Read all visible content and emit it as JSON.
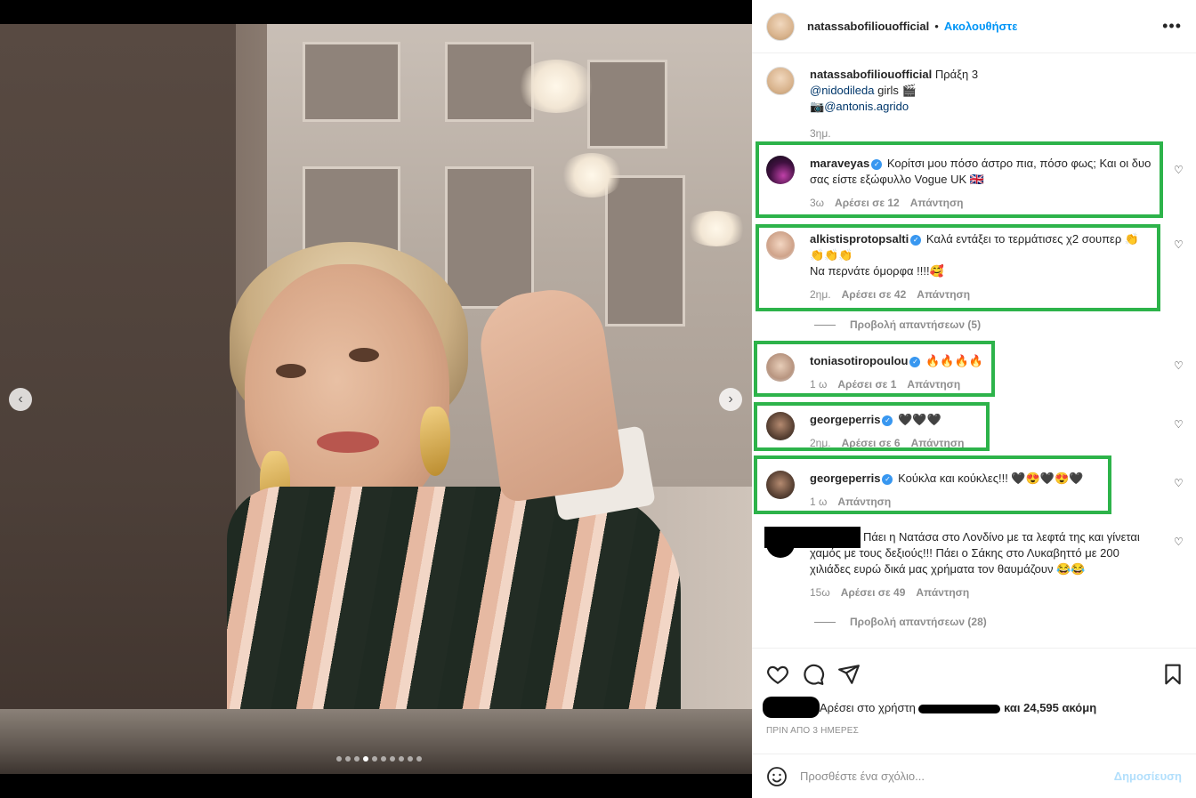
{
  "header": {
    "username": "natassabofiliouofficial",
    "separator": "•",
    "follow_label": "Ακολουθήστε",
    "more_icon": "more-icon"
  },
  "caption": {
    "username": "natassabofiliouofficial",
    "text_line1": "Πράξη 3",
    "mention1": "@nidodileda",
    "text_line2": " girls 🎬",
    "mention2": "@antonis.agrido",
    "mention2_prefix": "📷",
    "time": "3ημ."
  },
  "comments": [
    {
      "username": "maraveyas",
      "verified": true,
      "text": "Κορίτσι μου πόσο άστρο πια, πόσο φως; Και οι δυο σας είστε εξώφυλλο Vogue UK 🇬🇧",
      "time": "3ω",
      "likes": "Αρέσει σε 12",
      "reply": "Απάντηση"
    },
    {
      "username": "alkistisprotopsalti",
      "verified": true,
      "text": "Καλά εντάξει το τερμάτισες χ2 σουπερ 👏👏👏👏",
      "text2": "Να περνάτε όμορφα !!!!🥰",
      "time": "2ημ.",
      "likes": "Αρέσει σε 42",
      "reply": "Απάντηση"
    },
    {
      "username": "toniasotiropoulou",
      "verified": true,
      "text": "🔥🔥🔥🔥",
      "time": "1 ω",
      "likes": "Αρέσει σε 1",
      "reply": "Απάντηση"
    },
    {
      "username": "georgeperris",
      "verified": true,
      "text": "🖤🖤🖤",
      "time": "2ημ.",
      "likes": "Αρέσει σε 6",
      "reply": "Απάντηση"
    },
    {
      "username": "georgeperris",
      "verified": true,
      "text": "Κούκλα και κούκλες!!! 🖤😍🖤😍🖤",
      "time": "1 ω",
      "reply": "Απάντηση"
    },
    {
      "username": "",
      "text": "Πάει η Νατάσα στο Λονδίνο με τα λεφτά της και γίνεται χαμός με τους δεξιούς!!! Πάει ο Σάκης στο Λυκαβηττό με 200 χιλιάδες ευρώ δικά μας χρήματα τον θαυμάζουν 😂😂",
      "time": "15ω",
      "likes": "Αρέσει σε 49",
      "reply": "Απάντηση"
    }
  ],
  "view_replies": [
    "Προβολή απαντήσεων (5)",
    "Προβολή απαντήσεων (28)"
  ],
  "likes": {
    "prefix": "Αρέσει στο χρήστη",
    "suffix": "και 24,595 ακόμη"
  },
  "time_ago": "ΠΡΙΝ ΑΠΟ 3 ΗΜΕΡΕΣ",
  "add_comment": {
    "placeholder": "Προσθέστε ένα σχόλιο...",
    "post_label": "Δημοσίευση"
  },
  "carousel": {
    "count": 10,
    "active": 3
  },
  "colors": {
    "highlight": "#2db34a",
    "link": "#0095f6",
    "verified": "#3897f0"
  }
}
